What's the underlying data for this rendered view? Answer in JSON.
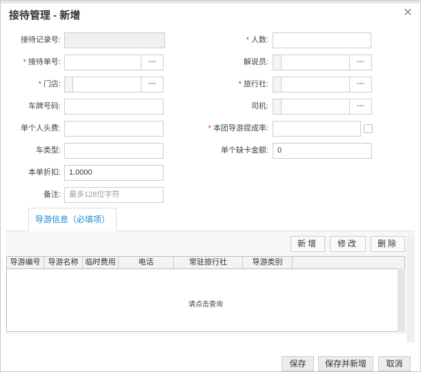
{
  "dialog": {
    "title": "接待管理 - 新增",
    "close_icon": "close-icon"
  },
  "form": {
    "record_no": {
      "label": "接待记录号:",
      "required": false,
      "value": ""
    },
    "people": {
      "label": "人数:",
      "required": true,
      "value": ""
    },
    "reception_no": {
      "label": "接待单号:",
      "required": true,
      "value": "",
      "button": "---"
    },
    "guide_explainer": {
      "label": "解说员:",
      "required": false,
      "value": "",
      "button": "---"
    },
    "store": {
      "label": "门店:",
      "required": true,
      "value": "",
      "button": "---"
    },
    "agency": {
      "label": "旅行社:",
      "required": true,
      "value": "",
      "button": "---"
    },
    "plate": {
      "label": "车牌号码:",
      "required": false,
      "value": ""
    },
    "driver": {
      "label": "司机:",
      "required": false,
      "value": "",
      "button": "---"
    },
    "per_head_fee": {
      "label": "单个人头费:",
      "required": false,
      "value": ""
    },
    "guide_rate": {
      "label": "本团导游提成率:",
      "required": true,
      "value": ""
    },
    "car_type": {
      "label": "车类型:",
      "required": false,
      "value": ""
    },
    "card_amount": {
      "label": "单个缺卡金额:",
      "required": false,
      "value": "0"
    },
    "discount": {
      "label": "本单折扣:",
      "required": false,
      "value": "1.0000"
    },
    "remark": {
      "label": "备注:",
      "required": false,
      "placeholder": "最多128位字符"
    }
  },
  "tab": {
    "label": "导游信息（必填项）"
  },
  "toolbar": {
    "add": "新增",
    "edit": "修改",
    "delete": "删除"
  },
  "grid": {
    "columns": [
      "导游编号",
      "导游名称",
      "临时费用",
      "电话",
      "常驻旅行社",
      "导游类别"
    ],
    "empty_text": "请点击查询"
  },
  "footer": {
    "save": "保存",
    "save_new": "保存并新增",
    "cancel": "取消"
  },
  "colors": {
    "accent": "#1a86d0",
    "required": "#e02b2b"
  }
}
